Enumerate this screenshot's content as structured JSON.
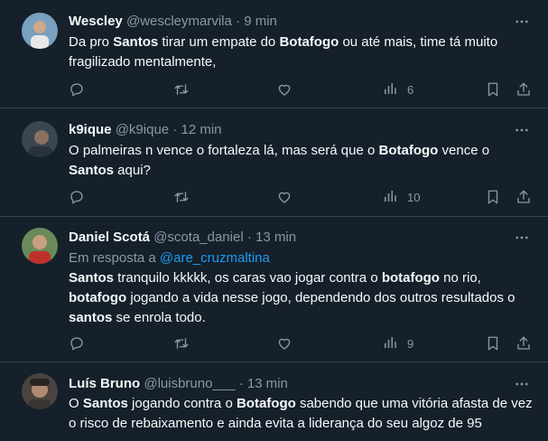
{
  "tweets": [
    {
      "name": "Wescley",
      "handle": "@wescleymarvila",
      "time": "9 min",
      "reply_to": null,
      "segments": [
        {
          "t": "Da pro ",
          "b": false
        },
        {
          "t": "Santos",
          "b": true
        },
        {
          "t": " tirar um empate do ",
          "b": false
        },
        {
          "t": "Botafogo",
          "b": true
        },
        {
          "t": " ou até mais, time tá muito fragilizado mentalmente,",
          "b": false
        }
      ],
      "views": "6",
      "avatar_color": "#6a8aa8"
    },
    {
      "name": "k9ique",
      "handle": "@k9ique",
      "time": "12 min",
      "reply_to": null,
      "segments": [
        {
          "t": "O palmeiras n vence o fortaleza lá, mas será que o ",
          "b": false
        },
        {
          "t": "Botafogo",
          "b": true
        },
        {
          "t": " vence o ",
          "b": false
        },
        {
          "t": "Santos",
          "b": true
        },
        {
          "t": " aqui?",
          "b": false
        }
      ],
      "views": "10",
      "avatar_color": "#4a5660"
    },
    {
      "name": "Daniel Scotá",
      "handle": "@scota_daniel",
      "time": "13 min",
      "reply_to": {
        "prefix": "Em resposta a ",
        "handle": "@are_cruzmaltina"
      },
      "segments": [
        {
          "t": "Santos",
          "b": true
        },
        {
          "t": " tranquilo kkkkk, os caras vao jogar contra o ",
          "b": false
        },
        {
          "t": "botafogo",
          "b": true
        },
        {
          "t": " no rio, ",
          "b": false
        },
        {
          "t": "botafogo",
          "b": true
        },
        {
          "t": " jogando a vida nesse jogo, dependendo dos outros resultados o ",
          "b": false
        },
        {
          "t": "santos",
          "b": true
        },
        {
          "t": " se enrola todo.",
          "b": false
        }
      ],
      "views": "9",
      "avatar_color": "#8a6a4a"
    },
    {
      "name": "Luís Bruno",
      "handle": "@luisbruno___",
      "time": "13 min",
      "reply_to": null,
      "segments": [
        {
          "t": "O ",
          "b": false
        },
        {
          "t": "Santos",
          "b": true
        },
        {
          "t": " jogando contra o ",
          "b": false
        },
        {
          "t": "Botafogo",
          "b": true
        },
        {
          "t": " sabendo que uma vitória afasta de vez o risco de rebaixamento e ainda evita a liderança do seu algoz de 95",
          "b": false
        }
      ],
      "views": null,
      "avatar_color": "#5a5048"
    }
  ],
  "separator": "·",
  "colors": {
    "background": "#15202b",
    "muted": "#8b98a5",
    "link": "#1d9bf0",
    "divider": "#38444d"
  },
  "icons": [
    "more-icon",
    "reply-icon",
    "retweet-icon",
    "like-icon",
    "views-icon",
    "bookmark-icon",
    "share-icon"
  ]
}
